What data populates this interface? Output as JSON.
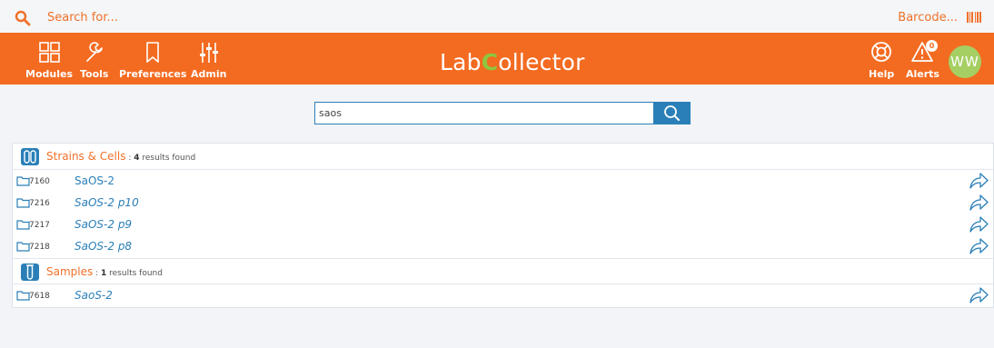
{
  "topbar": {
    "search_placeholder": "Search for...",
    "barcode_label": "Barcode..."
  },
  "nav": {
    "modules": "Modules",
    "tools": "Tools",
    "preferences": "Preferences",
    "admin": "Admin",
    "help": "Help",
    "alerts": "Alerts",
    "alerts_count": "0"
  },
  "logo": {
    "part1": "Lab",
    "part2": "C",
    "part3": "ollector"
  },
  "user": {
    "initials": "WW"
  },
  "search": {
    "value": "saos"
  },
  "sections": [
    {
      "title": "Strains & Cells",
      "separator": " : ",
      "count": "4",
      "count_suffix": " results found",
      "rows": [
        {
          "id": "7160",
          "name": "SaOS-2"
        },
        {
          "id": "7216",
          "name": "SaOS-2 p10"
        },
        {
          "id": "7217",
          "name": "SaOS-2 p9"
        },
        {
          "id": "7218",
          "name": "SaOS-2 p8"
        }
      ]
    },
    {
      "title": "Samples",
      "separator": " : ",
      "count": "1",
      "count_suffix": " results found",
      "rows": [
        {
          "id": "7618",
          "name": "SaoS-2"
        }
      ]
    }
  ],
  "colors": {
    "brand_orange": "#f36b21",
    "link_blue": "#2a7fb8",
    "logo_green": "#8dc63f",
    "avatar_green": "#a5cf63"
  }
}
